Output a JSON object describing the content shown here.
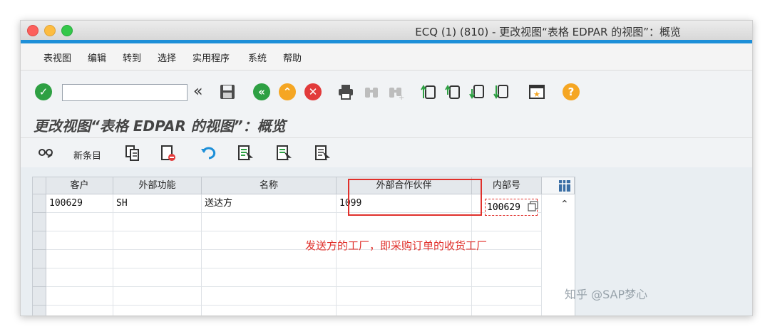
{
  "window": {
    "title": "ECQ (1) (810) - 更改视图“表格 EDPAR 的视图”：概览"
  },
  "menu": [
    "表视图",
    "编辑",
    "转到",
    "选择",
    "实用程序",
    "系统",
    "帮助"
  ],
  "toolbar": {
    "command_value": "",
    "collapse_glyph": "«",
    "help_glyph": "?"
  },
  "subtitle": "更改视图“表格 EDPAR 的视图”：概览",
  "app_toolbar": {
    "new_entries": "新条目"
  },
  "table": {
    "headers": [
      "客户",
      "外部功能",
      "名称",
      "外部合作伙伴",
      "内部号"
    ],
    "rows": [
      [
        "100629",
        "SH",
        "送达方",
        "1099",
        "100629"
      ]
    ]
  },
  "annotation": "发送方的工厂，即采购订单的收货工厂",
  "watermark": "知乎 @SAP梦心",
  "colors": {
    "accent": "#1d8fd8",
    "highlight": "#e0302b",
    "ok": "#2ea043",
    "back": "#2ea043",
    "exit": "#f5a623",
    "cancel": "#e23b3b"
  }
}
